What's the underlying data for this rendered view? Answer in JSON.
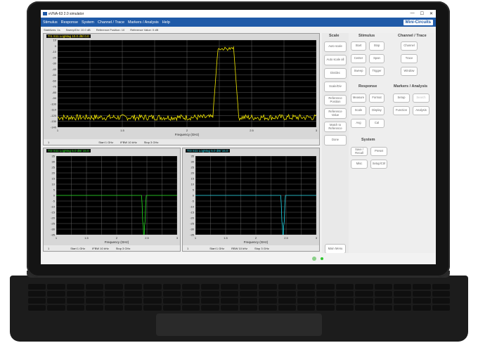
{
  "window": {
    "title": "eVNA-63 2.0 simulator",
    "controls": [
      "—",
      "☐",
      "✕"
    ]
  },
  "menu": [
    "Stimulus",
    "Response",
    "System",
    "Channel / Trace",
    "Markers / Analysis",
    "Help"
  ],
  "brand": "Mini-Circuits",
  "info": [
    "Stabilizes: 1s",
    "Sweep/Div: 10.0 dB",
    "Reference Position: 10",
    "Reference Value: 0 dB"
  ],
  "top_trace": {
    "label": "Tr1 S11 LogMag 10.0 dB/ 0.0",
    "yticks": [
      "10",
      "0",
      "-10",
      "-20",
      "-30",
      "-40",
      "-50",
      "-60",
      "-70",
      "-80",
      "-90",
      "-100",
      "-110",
      "-120",
      "-130",
      "-140"
    ],
    "xticks": [
      "1",
      "1.5",
      "2",
      "2.5",
      "3"
    ],
    "xlabel": "Frequency (GHz)",
    "ylabel": "dB",
    "foot": [
      "1",
      "Start 1 GHz",
      "IFBW 10 kHz",
      "Stop 3 GHz",
      "1"
    ]
  },
  "bl_trace": {
    "label": "Tr2 S11 LogMag 5.0 dB/ 15.0",
    "yticks": [
      "35",
      "30",
      "25",
      "20",
      "15",
      "10",
      "5",
      "0",
      "-5",
      "-10",
      "-15",
      "-20",
      "-25",
      "-30",
      "-35"
    ],
    "xticks": [
      "1",
      "1.5",
      "2",
      "2.5",
      "3"
    ],
    "xlabel": "Frequency (GHz)",
    "foot": [
      "1",
      "Start 1 GHz",
      "IFBW 10 kHz",
      "Stop 3 GHz"
    ]
  },
  "br_trace": {
    "label": "Tr3 S11 LogMag 5.0 dB/ 15.0",
    "yticks": [
      "35",
      "30",
      "25",
      "20",
      "15",
      "10",
      "5",
      "0",
      "-5",
      "-10",
      "-15",
      "-20",
      "-25",
      "-30",
      "-35"
    ],
    "xticks": [
      "1",
      "1.5",
      "2",
      "2.5",
      "3"
    ],
    "xlabel": "Frequency (GHz)",
    "foot": [
      "1",
      "Start 1 GHz",
      "RBW 10 kHz",
      "Stop 3 GHz"
    ]
  },
  "scale": {
    "title": "Scale",
    "buttons": [
      "Auto scale",
      "Auto scale all",
      "Div/dec",
      "Scale/Div",
      "Reference Position",
      "Reference Value",
      "Match to Reference",
      "Done"
    ]
  },
  "stimulus": {
    "title": "Stimulus",
    "buttons": [
      "Start",
      "Stop",
      "Center",
      "Span",
      "Sweep",
      "Trigger"
    ]
  },
  "channel": {
    "title": "Channel / Trace",
    "buttons": [
      "Channel",
      "Trace",
      "Window"
    ]
  },
  "response": {
    "title": "Response",
    "buttons": [
      "Measure",
      "Format",
      "Scale",
      "Display",
      "Avg",
      "Cal"
    ]
  },
  "markers": {
    "title": "Markers / Analysis",
    "buttons": [
      "Setup",
      "Search",
      "Function",
      "Analysis"
    ]
  },
  "system": {
    "title": "System",
    "buttons": [
      "Save / Recall",
      "Preset",
      "Misc",
      "Setup/Ctrl"
    ]
  },
  "main_menu": "Main Menu",
  "colors": {
    "trace1": "#f2e800",
    "trace2": "#22e01e",
    "trace3": "#20d8e8",
    "menubar": "#1f5aa8"
  }
}
